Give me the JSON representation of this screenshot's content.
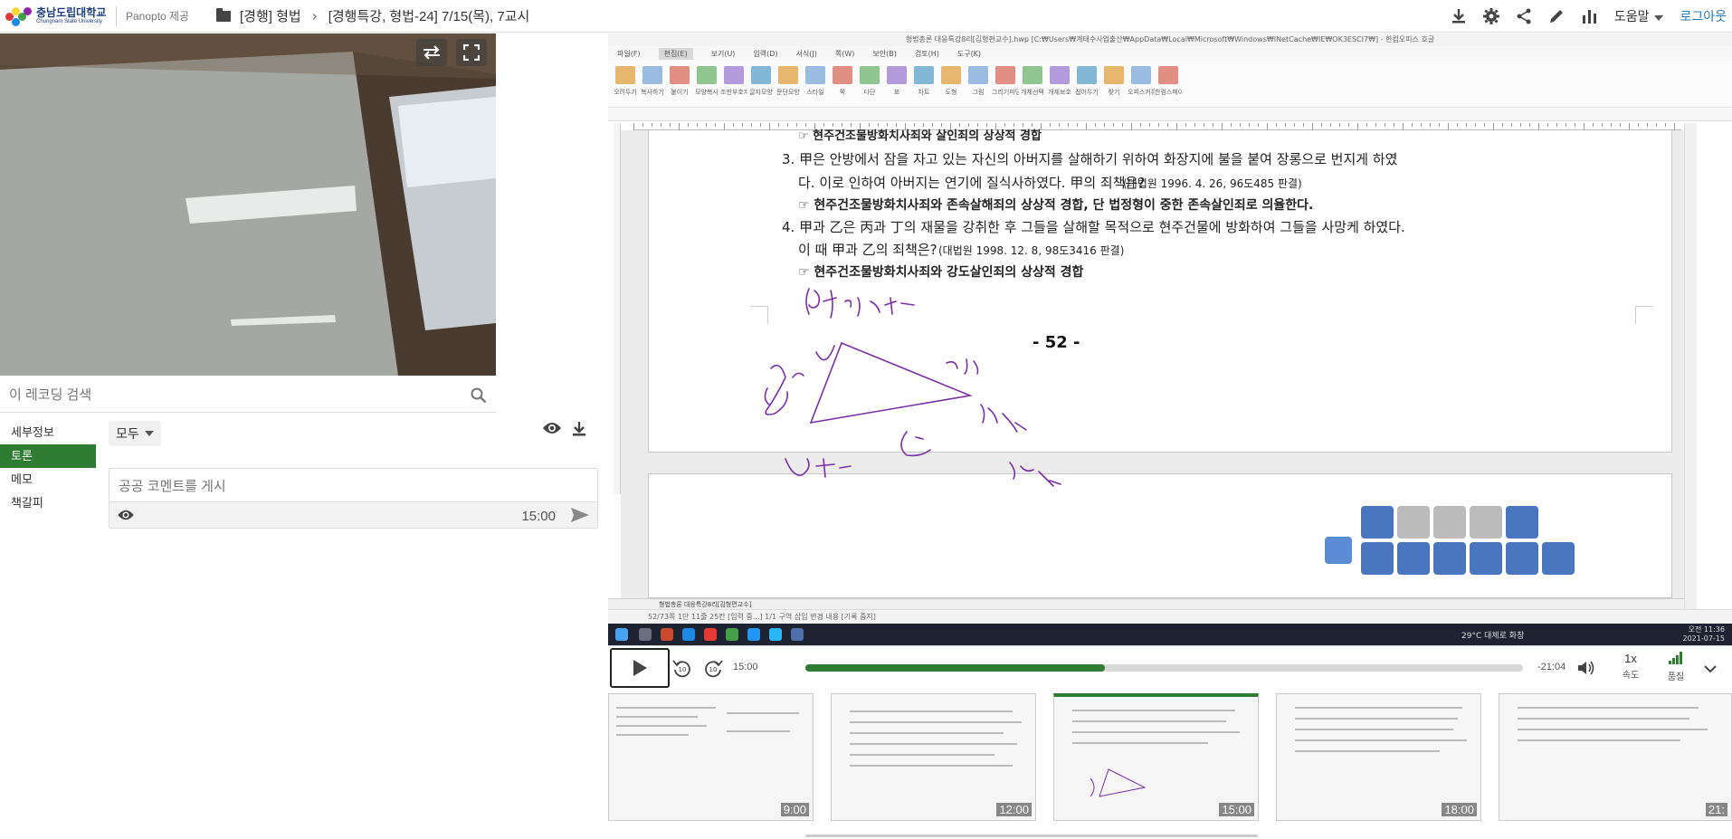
{
  "header": {
    "logo_kr": "충남도립대학교",
    "logo_en": "Chungnam State University",
    "powered": "Panopto 제공",
    "breadcrumb": [
      "[경행] 형법",
      "[경행특강, 형법-24] 7/15(목), 7교시"
    ],
    "help": "도움말",
    "login": "로그아웃",
    "icons": [
      "download-icon",
      "gear-icon",
      "share-icon",
      "edit-icon",
      "stats-icon"
    ]
  },
  "search": {
    "placeholder": "이 레코딩 검색"
  },
  "sidebar": {
    "tabs": [
      {
        "label": "세부정보",
        "active": false
      },
      {
        "label": "토론",
        "active": true
      },
      {
        "label": "메모",
        "active": false
      },
      {
        "label": "책갈피",
        "active": false
      }
    ]
  },
  "discussion": {
    "filter": "모두",
    "placeholder": "공공 코멘트를 게시",
    "time": "15:00"
  },
  "document": {
    "title_bar": "형법총론 대응특강8리[김형편교수].hwp [C:₩Users₩계태수사업출산₩AppData₩Local₩Microsoft₩Windows₩INetCache₩IE₩OK3ESCI7₩] - 한컴오피스 호글",
    "menu": [
      "파일(F)",
      "편집(E)",
      "보기(U)",
      "입력(D)",
      "서식(J)",
      "쪽(W)",
      "보안(B)",
      "검토(H)",
      "도구(K)"
    ],
    "toolbar": [
      "오려두기",
      "복사하기",
      "붙이기",
      "모양복사",
      "조판부호지우기",
      "글자모양",
      "문단모양",
      "스타일",
      "쪽",
      "다단",
      "표",
      "차트",
      "도형",
      "그림",
      "그리기마당",
      "개체선택",
      "개체보호",
      "접어두기",
      "찾기",
      "오피스커뮤니케이터",
      "한컴스페이스"
    ],
    "lines": [
      "☞ 현주건조물방화치사죄와 살인죄의 상상적 경합",
      "3. 甲은 안방에서 잠을 자고 있는 자신의 아버지를 살해하기 위하여 화장지에 불을 붙여 장롱으로 번지게 하였",
      "다. 이로 인하여 아버지는 연기에 질식사하였다. 甲의 죄책은?",
      "(대법원 1996. 4. 26, 96도485 판결)",
      "☞ 현주건조물방화치사죄와 존속살해죄의 상상적 경합, 단 법정형이 중한 존속살인죄로 의율한다.",
      "4. 甲과 乙은 丙과 丁의 재물을 강취한 후 그들을 살해할 목적으로 현주건물에 방화하여 그들을 사망케 하였다.",
      "이 때 甲과 乙의 죄책은?",
      "(대법원 1998. 12. 8, 98도3416 판결)",
      "☞ 현주건조물방화치사죄와 강도살인죄의 상상적 경합"
    ],
    "page_number": "- 52 -",
    "status": "52/73쪽  1단  11줄  25칸  [입력 중...]  1/1 구역  삽입  변경 내용 [기록 중지]",
    "tab_label": "형법총론 대응특강8리[김형편교수]",
    "tray_time": "오전 11:36",
    "tray_date": "2021-07-15",
    "weather": "29°C 대체로 화창"
  },
  "player": {
    "current": "15:00",
    "remaining": "-21:04",
    "progress": 0.417,
    "speed": "1x",
    "speed_label": "속도",
    "quality_label": "품질"
  },
  "thumbnails": [
    {
      "time": "9:00",
      "active": false
    },
    {
      "time": "12:00",
      "active": false
    },
    {
      "time": "15:00",
      "active": true
    },
    {
      "time": "18:00",
      "active": false
    },
    {
      "time": "21:",
      "active": false
    }
  ],
  "colors": {
    "accent": "#2f7d32",
    "link": "#2a7ab8",
    "ink": "#7b2fa8"
  }
}
